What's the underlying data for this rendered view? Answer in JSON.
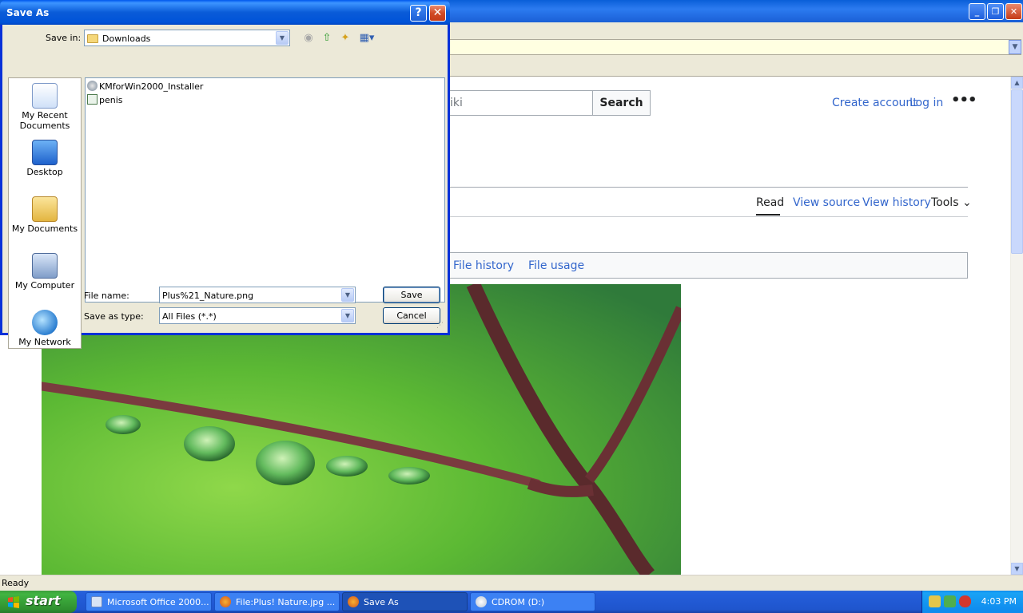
{
  "browser": {
    "status": "Ready",
    "wiki": {
      "search_placeholder": "iki",
      "search_button": "Search",
      "create_account": "Create account",
      "log_in": "Log in",
      "more": "•••",
      "tabs": [
        "Read",
        "View source",
        "View history",
        "Tools ⌄"
      ],
      "file_links": [
        "File history",
        "File usage"
      ]
    }
  },
  "dialog": {
    "title": "Save As",
    "help": "?",
    "close": "✕",
    "save_in_label": "Save in:",
    "save_in_value": "Downloads",
    "places": [
      "My Recent\nDocuments",
      "Desktop",
      "My Documents",
      "My Computer",
      "My Network"
    ],
    "files": [
      "KMforWin2000_Installer",
      "penis"
    ],
    "file_name_label": "File name:",
    "file_name_value": "Plus%21_Nature.png",
    "save_type_label": "Save as type:",
    "save_type_value": "All Files (*.*)",
    "save_button": "Save",
    "cancel_button": "Cancel"
  },
  "taskbar": {
    "start": "start",
    "tasks": [
      "Microsoft Office 2000...",
      "File:Plus! Nature.jpg ...",
      "Save As",
      "CDROM (D:)"
    ],
    "clock": "4:03 PM"
  },
  "colors": {
    "xp_blue": "#0831d9",
    "link": "#3366cc",
    "start_green": "#41b441"
  }
}
